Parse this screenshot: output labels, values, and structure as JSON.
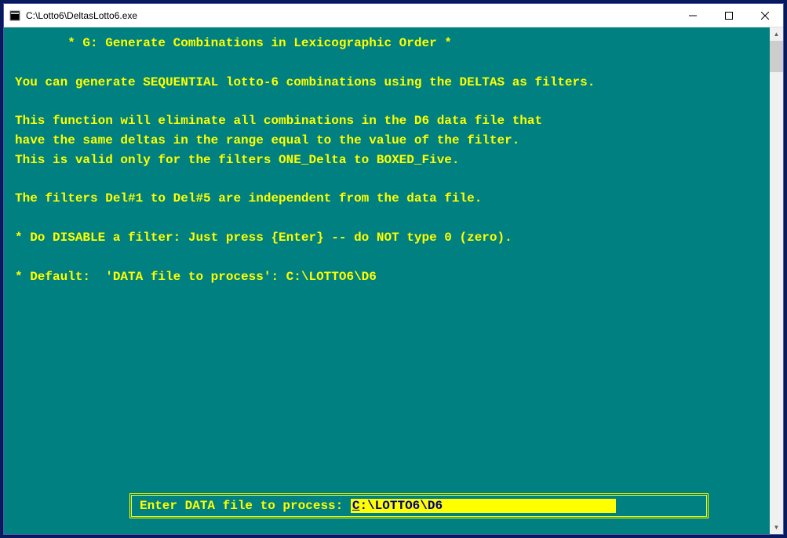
{
  "window": {
    "title": "C:\\Lotto6\\DeltasLotto6.exe"
  },
  "console": {
    "heading": "       * G: Generate Combinations in Lexicographic Order *",
    "line_intro": "You can generate SEQUENTIAL lotto-6 combinations using the DELTAS as filters.",
    "para2_l1": "This function will eliminate all combinations in the D6 data file that",
    "para2_l2": "have the same deltas in the range equal to the value of the filter.",
    "para2_l3": "This is valid only for the filters ONE_Delta to BOXED_Five.",
    "line_filters": "The filters Del#1 to Del#5 are independent from the data file.",
    "line_disable": "* Do DISABLE a filter: Just press {Enter} -- do NOT type 0 (zero).",
    "line_default": "* Default:  'DATA file to process': C:\\LOTTO6\\D6"
  },
  "prompt": {
    "label": " Enter DATA file to process: ",
    "value": "C:\\LOTTO6\\D6"
  }
}
